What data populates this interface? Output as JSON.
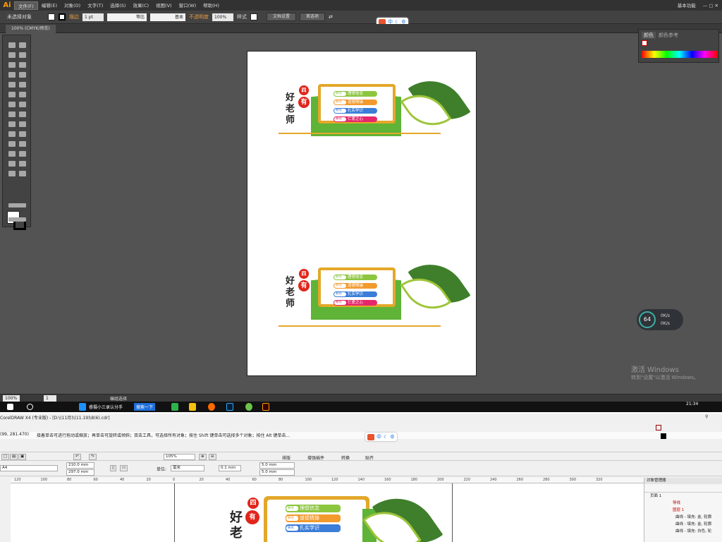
{
  "illustrator": {
    "menu": [
      "文件(F)",
      "编辑(E)",
      "对象(O)",
      "文字(T)",
      "选择(S)",
      "效果(C)",
      "视图(V)",
      "窗口(W)",
      "帮助(H)"
    ],
    "workspace": "基本功能",
    "control": {
      "selection": "未选择对象",
      "stroke_label": "描边",
      "stroke_value": "1 pt",
      "profile": "等比",
      "brush": "基本",
      "opacity_label": "不透明度",
      "opacity_value": "100%",
      "style_label": "样式",
      "doc_setup": "文档设置",
      "prefs": "首选项"
    },
    "doc_tab": "100% (CMYK/预览)",
    "panels": {
      "tab1": "颜色",
      "tab2": "颜色参考"
    },
    "status": {
      "zoom": "100%",
      "page": "1",
      "mode": "编组选择"
    },
    "perf": {
      "percent": "64",
      "up": "0K/s",
      "down": "0K/s"
    },
    "windows_notice": {
      "line1": "激活 Windows",
      "line2": "转到\"设置\"以激活 Windows。"
    },
    "taskbar": {
      "app1": "睿摄小三录认分手",
      "app2": "搜索一下",
      "time": "21:34"
    }
  },
  "artwork": {
    "title_top": "四",
    "title_circle": "有",
    "title_vertical": [
      "好",
      "老",
      "师"
    ],
    "pills": [
      {
        "tag": "要有",
        "text": "理想信念",
        "color": "#8cc63e"
      },
      {
        "tag": "要有",
        "text": "道德情操",
        "color": "#f29a2e"
      },
      {
        "tag": "要有",
        "text": "扎实学识",
        "color": "#3b7dd8"
      },
      {
        "tag": "要有",
        "text": "仁爱之心",
        "color": "#e5286c"
      }
    ]
  },
  "coreldraw": {
    "title": "CorelDRAW X4 (专业版) - [D:\\(11月)\\(11.19)\\8(6).cdr]",
    "hint_coords": "(99, 281.470)",
    "hint": "接着单击可进行拖动或缩放；再单击可旋转或倾斜；双击工具，可选择所有对象；按住 Shift 键单击可选择多个对象；按住 Alt 键单击...",
    "toolbar": {
      "zoom": "105%",
      "paste": "贴齐",
      "arrange": "排版",
      "plugins": "增强插件",
      "convert": "转换"
    },
    "property": {
      "paper": "A4",
      "width": "210.0 mm",
      "height": "297.0 mm",
      "units_label": "单位:",
      "units": "毫米",
      "nudge": "0.1 mm",
      "dup_x": "5.0 mm",
      "dup_y": "5.0 mm"
    },
    "ruler": [
      "120",
      "100",
      "80",
      "60",
      "40",
      "20",
      "0",
      "20",
      "40",
      "60",
      "80",
      "100",
      "120",
      "140",
      "160",
      "180",
      "200",
      "220",
      "240",
      "260",
      "280",
      "300",
      "320"
    ],
    "objmgr": {
      "title": "对象管理器",
      "page": "页面 1",
      "layer1": "导线",
      "layer2": "图层 1",
      "items": [
        "曲线 - 填充: 金, 轮廓",
        "曲线 - 填充: 金, 轮廓",
        "曲线 - 填充: 白色, 轮"
      ]
    }
  }
}
